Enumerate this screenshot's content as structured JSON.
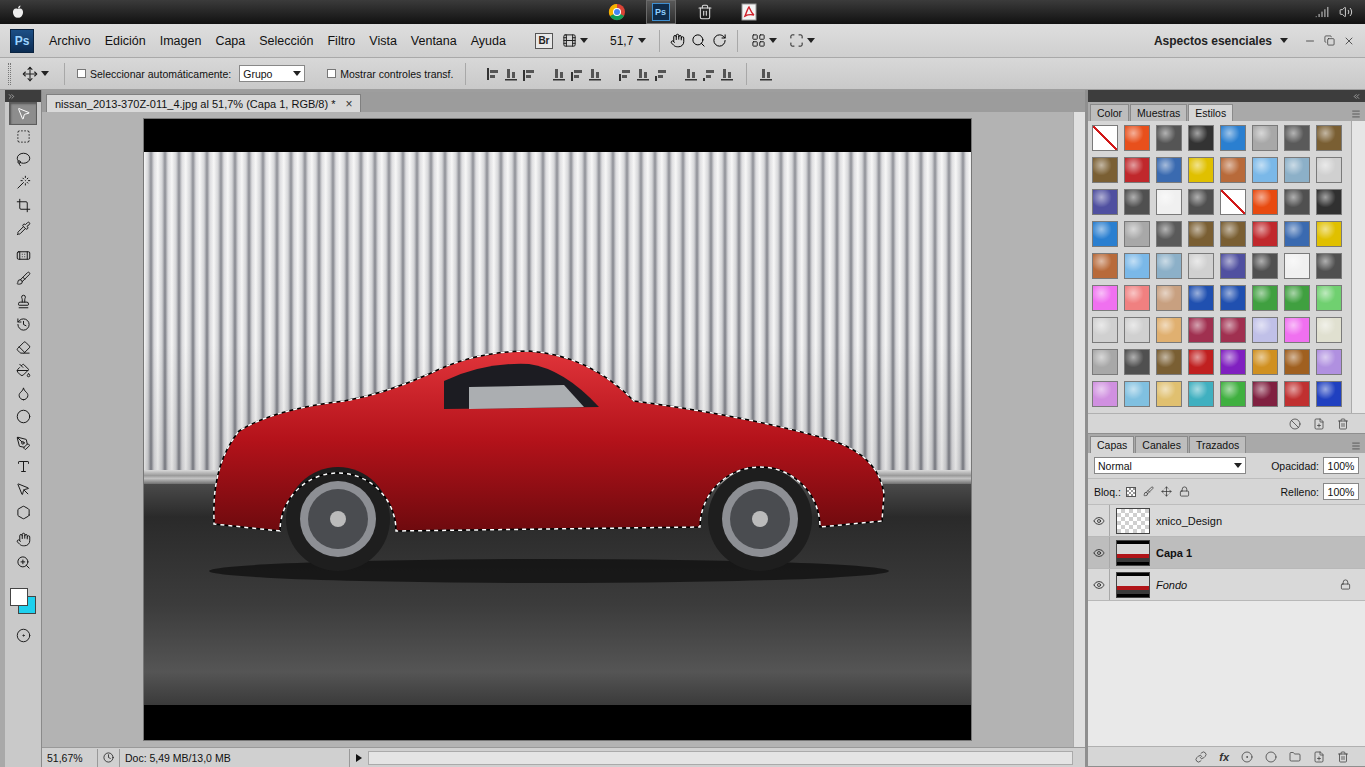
{
  "os_bar": {
    "apps": [
      {
        "kind": "chrome",
        "selected": false
      },
      {
        "kind": "photoshop",
        "label": "Ps",
        "selected": true
      },
      {
        "kind": "trash",
        "selected": false
      },
      {
        "kind": "acrobat",
        "selected": false
      }
    ]
  },
  "app_logo": "Ps",
  "menu": [
    "Archivo",
    "Edición",
    "Imagen",
    "Capa",
    "Selección",
    "Filtro",
    "Vista",
    "Ventana",
    "Ayuda"
  ],
  "app_bar": {
    "bridge": "Br",
    "zoom": "51,7",
    "workspace": "Aspectos esenciales"
  },
  "options_bar": {
    "auto_select": {
      "label": "Seleccionar automáticamente:",
      "checked": false
    },
    "auto_select_value": "Grupo",
    "show_transform": {
      "label": "Mostrar controles transf.",
      "checked": false
    }
  },
  "tools": [
    {
      "kind": "move",
      "selected": true
    },
    {
      "kind": "marquee",
      "selected": false
    },
    {
      "kind": "lasso",
      "selected": false
    },
    {
      "kind": "wand",
      "selected": false
    },
    {
      "kind": "crop",
      "selected": false
    },
    {
      "kind": "eyedropper",
      "selected": false
    },
    {
      "kind": "healing",
      "selected": false
    },
    {
      "kind": "brush",
      "selected": false
    },
    {
      "kind": "stamp",
      "selected": false
    },
    {
      "kind": "history",
      "selected": false
    },
    {
      "kind": "eraser",
      "selected": false
    },
    {
      "kind": "bucket",
      "selected": false
    },
    {
      "kind": "blur",
      "selected": false
    },
    {
      "kind": "dodge",
      "selected": false
    },
    {
      "kind": "pen",
      "selected": false
    },
    {
      "kind": "type",
      "selected": false
    },
    {
      "kind": "path",
      "selected": false
    },
    {
      "kind": "shape",
      "selected": false
    },
    {
      "kind": "hand",
      "selected": false
    },
    {
      "kind": "zoom",
      "selected": false
    }
  ],
  "colors": {
    "foreground": "#ffffff",
    "background": "#1ed0ee"
  },
  "document": {
    "title": "nissan_2013-370Z-011_4.jpg al 51,7% (Capa 1, RGB/8) *",
    "close": "×",
    "selected": true
  },
  "canvas": {
    "selection": true
  },
  "status_bar": {
    "zoom": "51,67%",
    "doc": "Doc: 5,49 MB/13,0 MB"
  },
  "styles_panel": {
    "tabs": [
      {
        "label": "Color",
        "selected": false
      },
      {
        "label": "Muestras",
        "selected": false
      },
      {
        "label": "Estilos",
        "selected": true
      }
    ],
    "swatches": [
      {
        "kind": "none",
        "color": "#ffffff"
      },
      {
        "kind": "style",
        "color": "#e8501c"
      },
      {
        "kind": "style",
        "color": "#555555"
      },
      {
        "kind": "style",
        "color": "#333333"
      },
      {
        "kind": "style",
        "color": "#2a7fd0"
      },
      {
        "kind": "style",
        "color": "#a8a8a8"
      },
      {
        "kind": "style",
        "color": "#5a5a5a"
      },
      {
        "kind": "style",
        "color": "#7a5f33"
      },
      {
        "kind": "style",
        "color": "#7a5f33"
      },
      {
        "kind": "style",
        "color": "#c0282c"
      },
      {
        "kind": "style",
        "color": "#3a6ab0"
      },
      {
        "kind": "style",
        "color": "#e0c000"
      },
      {
        "kind": "style",
        "color": "#b86a3a"
      },
      {
        "kind": "style",
        "color": "#7ab8e8"
      },
      {
        "kind": "style",
        "color": "#8cb0c8"
      },
      {
        "kind": "style",
        "color": "#d0d0d0"
      },
      {
        "kind": "style",
        "color": "#5050a0"
      },
      {
        "kind": "style",
        "color": "#505050"
      },
      {
        "kind": "style",
        "color": "#f0f0f0"
      },
      {
        "kind": "style",
        "color": "#505050"
      },
      {
        "kind": "none",
        "color": "#ffffff"
      },
      {
        "kind": "style",
        "color": "#e84a10"
      },
      {
        "kind": "style",
        "color": "#505050"
      },
      {
        "kind": "style",
        "color": "#303030"
      },
      {
        "kind": "style",
        "color": "#2a7fd0"
      },
      {
        "kind": "style",
        "color": "#a8a8a8"
      },
      {
        "kind": "style",
        "color": "#5a5a5a"
      },
      {
        "kind": "style",
        "color": "#7a5f33"
      },
      {
        "kind": "style",
        "color": "#7a5f33"
      },
      {
        "kind": "style",
        "color": "#c0282c"
      },
      {
        "kind": "style",
        "color": "#3a6ab0"
      },
      {
        "kind": "style",
        "color": "#e0c000"
      },
      {
        "kind": "style",
        "color": "#b86a3a"
      },
      {
        "kind": "style",
        "color": "#7ab8e8"
      },
      {
        "kind": "style",
        "color": "#8cb0c8"
      },
      {
        "kind": "style",
        "color": "#d0d0d0"
      },
      {
        "kind": "style",
        "color": "#5050a0"
      },
      {
        "kind": "style",
        "color": "#505050"
      },
      {
        "kind": "style",
        "color": "#f0f0f0"
      },
      {
        "kind": "style",
        "color": "#505050"
      },
      {
        "kind": "style",
        "color": "#f070f0"
      },
      {
        "kind": "style",
        "color": "#f08080"
      },
      {
        "kind": "style",
        "color": "#c8a080"
      },
      {
        "kind": "style",
        "color": "#2050b0"
      },
      {
        "kind": "style",
        "color": "#2050b0"
      },
      {
        "kind": "style",
        "color": "#40a040"
      },
      {
        "kind": "style",
        "color": "#40a040"
      },
      {
        "kind": "style",
        "color": "#70d070"
      },
      {
        "kind": "style",
        "color": "#d0d0d0"
      },
      {
        "kind": "style",
        "color": "#d0d0d0"
      },
      {
        "kind": "style",
        "color": "#e0b070"
      },
      {
        "kind": "style",
        "color": "#a03050"
      },
      {
        "kind": "style",
        "color": "#a03050"
      },
      {
        "kind": "style",
        "color": "#c0c0e8"
      },
      {
        "kind": "style",
        "color": "#f070f0"
      },
      {
        "kind": "style",
        "color": "#e0e0d0"
      },
      {
        "kind": "style",
        "color": "#a8a8a8"
      },
      {
        "kind": "style",
        "color": "#505050"
      },
      {
        "kind": "style",
        "color": "#7a5f33"
      },
      {
        "kind": "style",
        "color": "#c02020"
      },
      {
        "kind": "style",
        "color": "#8020c0"
      },
      {
        "kind": "style",
        "color": "#d09020"
      },
      {
        "kind": "style",
        "color": "#a06020"
      },
      {
        "kind": "style",
        "color": "#b090e0"
      },
      {
        "kind": "style",
        "color": "#d090e0"
      },
      {
        "kind": "style",
        "color": "#80c0e0"
      },
      {
        "kind": "style",
        "color": "#e0c070"
      },
      {
        "kind": "style",
        "color": "#40b0c0"
      },
      {
        "kind": "style",
        "color": "#40b040"
      },
      {
        "kind": "style",
        "color": "#802040"
      },
      {
        "kind": "style",
        "color": "#c03030"
      },
      {
        "kind": "style",
        "color": "#2040c0"
      }
    ]
  },
  "layers_panel": {
    "tabs": [
      {
        "label": "Capas",
        "selected": true
      },
      {
        "label": "Canales",
        "selected": false
      },
      {
        "label": "Trazados",
        "selected": false
      }
    ],
    "blend_mode": "Normal",
    "opacity_label": "Opacidad:",
    "opacity": "100%",
    "lock_label": "Bloq.:",
    "fill_label": "Relleno:",
    "fill": "100%",
    "layers": [
      {
        "name": "xnico_Design",
        "kind": "transparent",
        "visible": true,
        "selected": false,
        "locked": false
      },
      {
        "name": "Capa 1",
        "kind": "photo",
        "visible": true,
        "selected": true,
        "locked": false
      },
      {
        "name": "Fondo",
        "kind": "photo",
        "visible": true,
        "selected": false,
        "locked": true
      }
    ],
    "footer_fx": "fx"
  }
}
